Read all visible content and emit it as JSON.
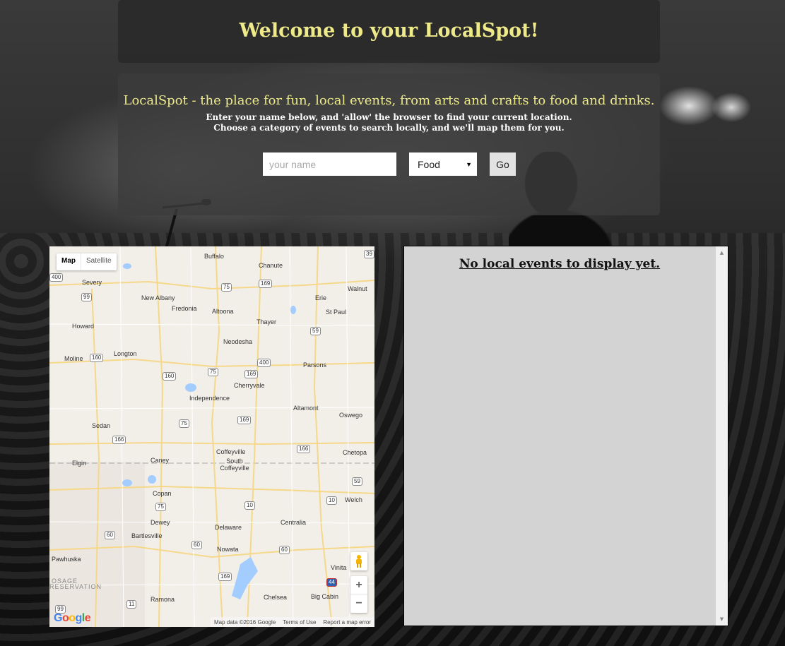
{
  "header": {
    "title": "Welcome to your LocalSpot!"
  },
  "intro": {
    "tagline": "LocalSpot - the place for fun, local events, from arts and crafts to food and drinks.",
    "line1": "Enter your name below, and 'allow' the browser to find your current location.",
    "line2": "Choose a category of events to search locally, and we'll map them for you."
  },
  "form": {
    "name_placeholder": "your name",
    "name_value": "",
    "category_selected": "Food",
    "go_label": "Go"
  },
  "map": {
    "type_options": [
      "Map",
      "Satellite"
    ],
    "active_type": "Map",
    "cities": [
      "Buffalo",
      "Chanute",
      "Walnut",
      "Severy",
      "New Albany",
      "Fredonia",
      "Altoona",
      "Erie",
      "St Paul",
      "Howard",
      "Thayer",
      "Neodesha",
      "Longton",
      "Moline",
      "Parsons",
      "Cherryvale",
      "Independence",
      "Altamont",
      "Oswego",
      "Sedan",
      "Coffeyville",
      "Chetopa",
      "Elgin",
      "Caney",
      "South Coffeyville",
      "Copan",
      "Welch",
      "Dewey",
      "Centralia",
      "Delaware",
      "Bartlesville",
      "Nowata",
      "Pawhuska",
      "Vinita",
      "Ramona",
      "Chelsea",
      "Big Cabin",
      "OSAGE",
      "RESERVATION"
    ],
    "shields": [
      "39",
      "400",
      "75",
      "169",
      "99",
      "59",
      "160",
      "400",
      "169",
      "75",
      "160",
      "75",
      "169",
      "166",
      "166",
      "59",
      "10",
      "10",
      "75",
      "60",
      "60",
      "60",
      "169",
      "44",
      "11",
      "99"
    ],
    "zoom_in": "+",
    "zoom_out": "−",
    "logo": "Google",
    "footer": [
      "Map data ©2016 Google",
      "Terms of Use",
      "Report a map error"
    ]
  },
  "events": {
    "message": "No local events to display yet."
  },
  "colors": {
    "accent_yellow": "#eeea8a",
    "panel_dark": "#282828",
    "events_bg": "#d3d3d3"
  }
}
